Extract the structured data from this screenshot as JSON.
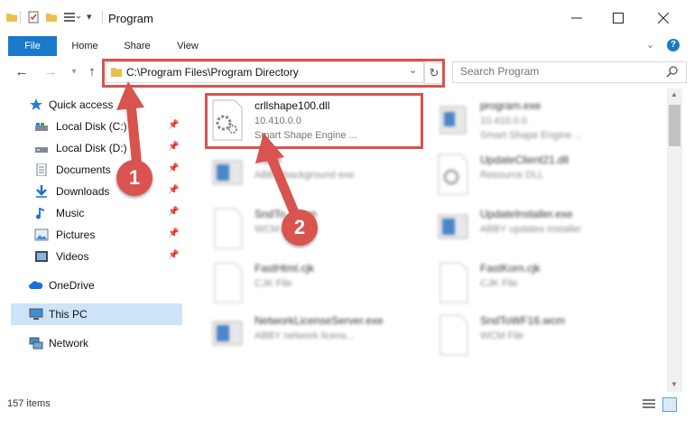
{
  "window": {
    "title": "Program"
  },
  "ribbon": {
    "tabs": [
      "File",
      "Home",
      "Share",
      "View"
    ]
  },
  "address": {
    "path": "C:\\Program Files\\Program Directory"
  },
  "search": {
    "placeholder": "Search Program"
  },
  "nav": {
    "quick_access": "Quick access",
    "items": [
      {
        "label": "Local Disk (C:)",
        "icon": "drive-icon"
      },
      {
        "label": "Local Disk (D:)",
        "icon": "drive-icon"
      },
      {
        "label": "Documents",
        "icon": "documents-icon"
      },
      {
        "label": "Downloads",
        "icon": "downloads-icon"
      },
      {
        "label": "Music",
        "icon": "music-icon"
      },
      {
        "label": "Pictures",
        "icon": "pictures-icon"
      },
      {
        "label": "Videos",
        "icon": "videos-icon"
      }
    ],
    "onedrive": "OneDrive",
    "this_pc": "This PC",
    "network": "Network"
  },
  "files": [
    {
      "name": "crllshape100.dll",
      "version": "10.410.0.0",
      "desc": "Smart Shape Engine ..."
    },
    {
      "name": "program.exe",
      "version": "10.410.0.0",
      "desc": "Smart Shape Engine ..."
    },
    {
      "name": "...exe",
      "version": "ABBY background exe",
      "desc": ""
    },
    {
      "name": "UpdateClient21.dll",
      "version": "Resource DLL",
      "desc": ""
    },
    {
      "name": "SndTo...wcm",
      "version": "WCM File",
      "desc": ""
    },
    {
      "name": "UpdateInstaller.exe",
      "version": "ABBY updates installer",
      "desc": ""
    },
    {
      "name": "FastHtml.cjk",
      "version": "CJK File",
      "desc": ""
    },
    {
      "name": "FastKorn.cjk",
      "version": "CJK File",
      "desc": ""
    },
    {
      "name": "NetworkLicenseServer.exe",
      "version": "ABBY network licens...",
      "desc": ""
    },
    {
      "name": "SndToWF16.wcm",
      "version": "WCM File",
      "desc": ""
    }
  ],
  "status": {
    "item_count": "157 items"
  },
  "annotations": {
    "step1": "1",
    "step2": "2"
  },
  "colors": {
    "accent": "#1979ca",
    "callout": "#d9534f",
    "selected_nav": "#cce4f7"
  }
}
